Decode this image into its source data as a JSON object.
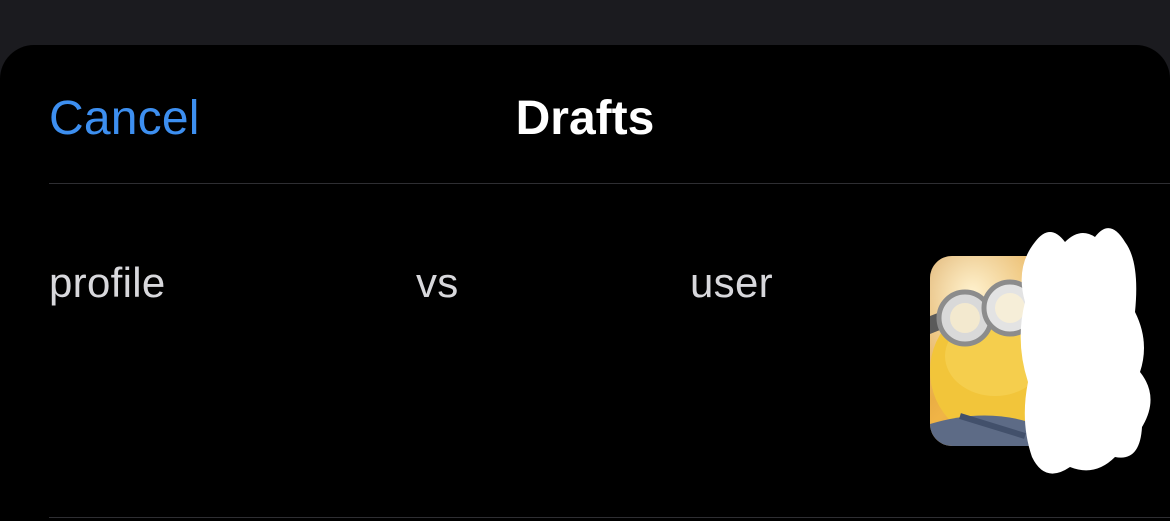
{
  "header": {
    "cancel_label": "Cancel",
    "title": "Drafts"
  },
  "drafts": [
    {
      "words": [
        "profile",
        "vs",
        "user"
      ],
      "thumbnail_icon": "minion-photo-thumbnail"
    }
  ],
  "colors": {
    "accent": "#3d8ff0",
    "sheet_background": "#000000",
    "backdrop": "#1b1b1f",
    "text_primary": "#ffffff",
    "text_secondary": "#d8d8dc"
  }
}
